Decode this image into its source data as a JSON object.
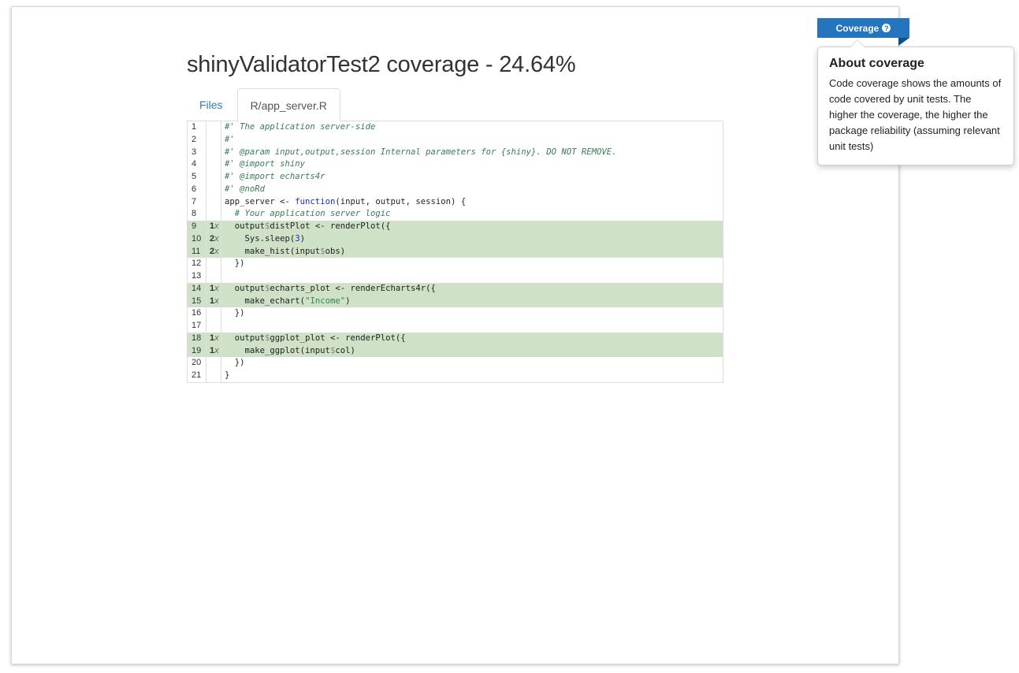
{
  "page": {
    "title": "shinyValidatorTest2 coverage - 24.64%"
  },
  "tabs": [
    {
      "label": "Files"
    },
    {
      "label": "R/app_server.R"
    }
  ],
  "coverage_button": {
    "label": "Coverage"
  },
  "popover": {
    "title": "About coverage",
    "body": "Code coverage shows the amounts of code covered by unit tests. The higher the coverage, the higher the package reliability (assuming relevant unit tests)"
  },
  "colors": {
    "accent": "#2474be",
    "covered_row": "#cfe1c7"
  },
  "code_lines": [
    {
      "n": "1",
      "hits": "",
      "text": "#' The application server-side"
    },
    {
      "n": "2",
      "hits": "",
      "text": "#'"
    },
    {
      "n": "3",
      "hits": "",
      "text": "#' @param input,output,session Internal parameters for {shiny}. DO NOT REMOVE."
    },
    {
      "n": "4",
      "hits": "",
      "text": "#' @import shiny"
    },
    {
      "n": "5",
      "hits": "",
      "text": "#' @import echarts4r"
    },
    {
      "n": "6",
      "hits": "",
      "text": "#' @noRd"
    },
    {
      "n": "7",
      "hits": "",
      "text": "app_server <- function(input, output, session) {"
    },
    {
      "n": "8",
      "hits": "",
      "text": "  # Your application server logic"
    },
    {
      "n": "9",
      "hits": "1",
      "text": "  output$distPlot <- renderPlot({"
    },
    {
      "n": "10",
      "hits": "2",
      "text": "    Sys.sleep(3)"
    },
    {
      "n": "11",
      "hits": "2",
      "text": "    make_hist(input$obs)"
    },
    {
      "n": "12",
      "hits": "",
      "text": "  })"
    },
    {
      "n": "13",
      "hits": "",
      "text": ""
    },
    {
      "n": "14",
      "hits": "1",
      "text": "  output$echarts_plot <- renderEcharts4r({"
    },
    {
      "n": "15",
      "hits": "1",
      "text": "    make_echart(\"Income\")"
    },
    {
      "n": "16",
      "hits": "",
      "text": "  })"
    },
    {
      "n": "17",
      "hits": "",
      "text": ""
    },
    {
      "n": "18",
      "hits": "1",
      "text": "  output$ggplot_plot <- renderPlot({"
    },
    {
      "n": "19",
      "hits": "1",
      "text": "    make_ggplot(input$col)"
    },
    {
      "n": "20",
      "hits": "",
      "text": "  })"
    },
    {
      "n": "21",
      "hits": "",
      "text": "}"
    }
  ]
}
